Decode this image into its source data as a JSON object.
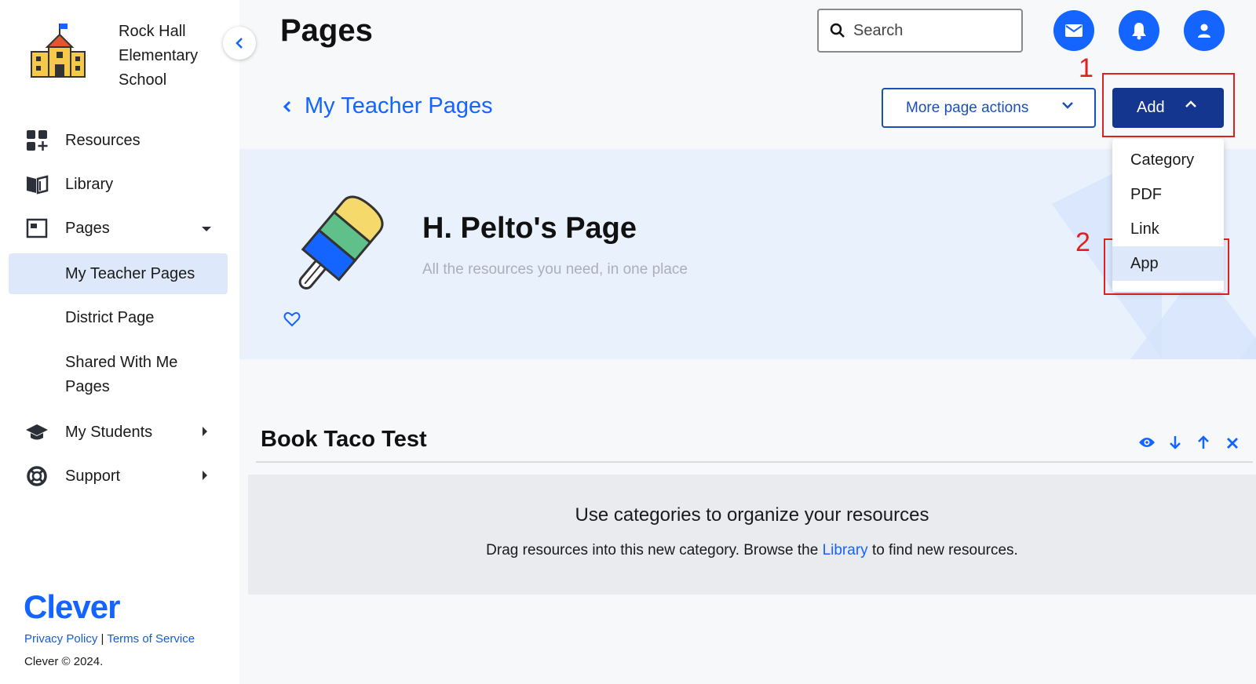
{
  "sidebar": {
    "school_name": "Rock Hall Elementary School",
    "items": {
      "resources": "Resources",
      "library": "Library",
      "pages": "Pages",
      "my_students": "My Students",
      "support": "Support"
    },
    "sub_items": {
      "my_teacher_pages": "My Teacher Pages",
      "district_page": "District Page",
      "shared_with_me": "Shared With Me Pages"
    },
    "brand": "Clever",
    "privacy": "Privacy Policy",
    "separator": "|",
    "terms": "Terms of Service",
    "copyright": "Clever © 2024."
  },
  "header": {
    "title": "Pages",
    "search_placeholder": "Search"
  },
  "toolbar": {
    "back_label": "My Teacher Pages",
    "more_actions": "More page actions",
    "add": "Add"
  },
  "dropdown": {
    "items": [
      "Category",
      "PDF",
      "Link",
      "App"
    ],
    "selected": "App"
  },
  "annotations": [
    "1",
    "2"
  ],
  "hero": {
    "title": "H. Pelto's Page",
    "subtitle": "All the resources you need, in one place"
  },
  "category": {
    "title": "Book Taco Test",
    "empty_title": "Use categories to organize your resources",
    "empty_desc_before": "Drag resources into this new category. Browse the",
    "empty_link": "Library",
    "empty_desc_after": "to find new resources."
  },
  "colors": {
    "accent": "#1464ff",
    "add_button": "#14368f",
    "annotation": "#e02020",
    "hero_bg": "#e9f1fd",
    "active_nav": "#dde9fa"
  }
}
